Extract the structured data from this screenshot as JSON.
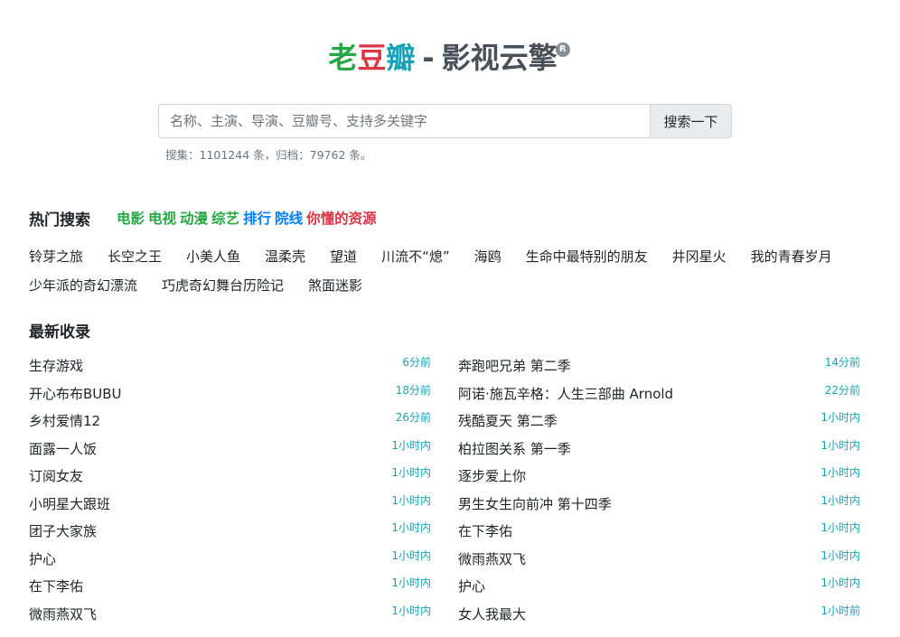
{
  "logo": {
    "part1": "老",
    "part2": "豆",
    "part3": "瓣",
    "separator": "-",
    "subtitle": "影视云擎",
    "badge": "R",
    "colors": {
      "part1": "#28a745",
      "part2": "#dc3545",
      "part3": "#17a2b8",
      "subtitle": "#495057"
    }
  },
  "search": {
    "placeholder": "名称、主演、导演、豆瓣号、支持多关键字",
    "value": "",
    "button_label": "搜索一下"
  },
  "stats": "搜集：1101244 条，归档：79762 条。",
  "hot": {
    "title": "热门搜索",
    "categories": [
      {
        "label": "电影",
        "color": "#28a745"
      },
      {
        "label": "电视",
        "color": "#28a745"
      },
      {
        "label": "动漫",
        "color": "#28a745"
      },
      {
        "label": "综艺",
        "color": "#28a745"
      },
      {
        "label": "排行",
        "color": "#007bff"
      },
      {
        "label": "院线",
        "color": "#007bff"
      },
      {
        "label": "你懂的资源",
        "color": "#dc3545"
      }
    ],
    "tags": [
      "铃芽之旅",
      "长空之王",
      "小美人鱼",
      "温柔壳",
      "望道",
      "川流不“熄”",
      "海鸥",
      "生命中最特别的朋友",
      "井冈星火",
      "我的青春岁月",
      "少年派的奇幻漂流",
      "巧虎奇幻舞台历险记",
      "煞面迷影"
    ]
  },
  "latest": {
    "title": "最新收录",
    "left": [
      {
        "title": "生存游戏",
        "time": "6分前"
      },
      {
        "title": "开心布布BUBU",
        "time": "18分前"
      },
      {
        "title": "乡村爱情12",
        "time": "26分前"
      },
      {
        "title": "面露一人饭",
        "time": "1小时内"
      },
      {
        "title": "订阅女友",
        "time": "1小时内"
      },
      {
        "title": "小明星大跟班",
        "time": "1小时内"
      },
      {
        "title": "团子大家族",
        "time": "1小时内"
      },
      {
        "title": "护心",
        "time": "1小时内"
      },
      {
        "title": "在下李佑",
        "time": "1小时内"
      },
      {
        "title": "微雨燕双飞",
        "time": "1小时内"
      }
    ],
    "right": [
      {
        "title": "奔跑吧兄弟 第二季",
        "time": "14分前"
      },
      {
        "title": "阿诺·施瓦辛格：人生三部曲 Arnold",
        "time": "22分前"
      },
      {
        "title": "残酷夏天 第二季",
        "time": "1小时内"
      },
      {
        "title": "柏拉图关系 第一季",
        "time": "1小时内"
      },
      {
        "title": "逐步爱上你",
        "time": "1小时内"
      },
      {
        "title": "男生女生向前冲 第十四季",
        "time": "1小时内"
      },
      {
        "title": "在下李佑",
        "time": "1小时内"
      },
      {
        "title": "微雨燕双飞",
        "time": "1小时内"
      },
      {
        "title": "护心",
        "time": "1小时内"
      },
      {
        "title": "女人我最大",
        "time": "1小时前"
      }
    ]
  }
}
